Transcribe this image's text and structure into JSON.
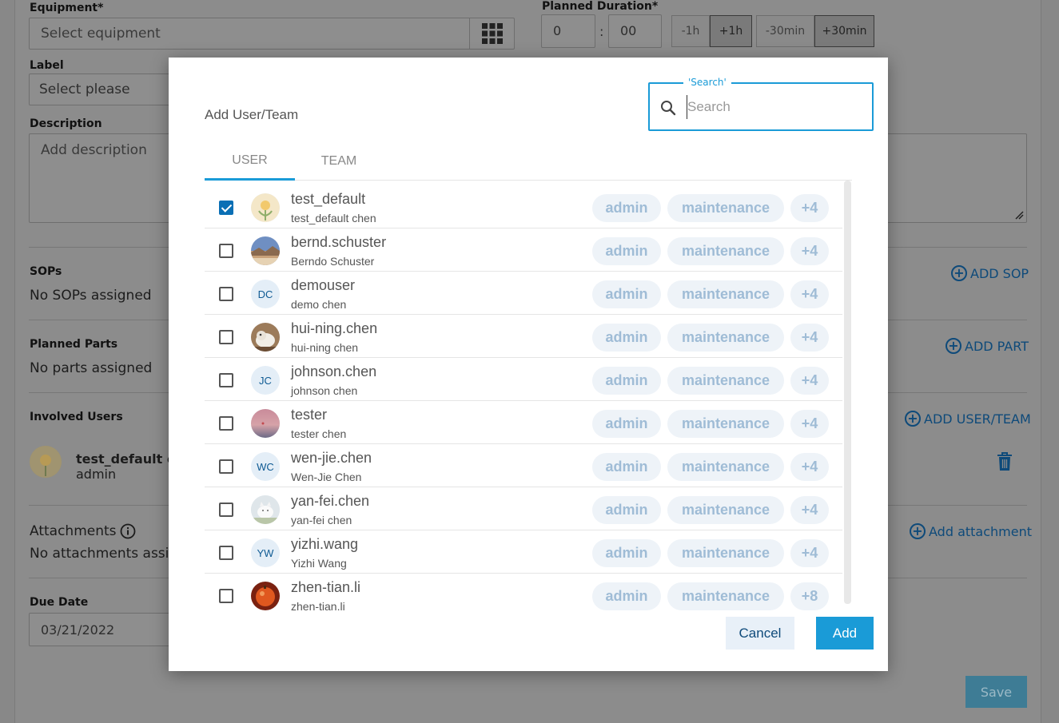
{
  "background": {
    "equipment_label": "Equipment*",
    "equipment_placeholder": "Select equipment",
    "planned_duration_label": "Planned Duration*",
    "duration_hours": "0",
    "duration_sep": ":",
    "duration_minutes": "00",
    "dur_minus_1h": "-1h",
    "dur_plus_1h": "+1h",
    "dur_minus_30": "-30min",
    "dur_plus_30": "+30min",
    "label_label": "Label",
    "label_placeholder": "Select please",
    "description_label": "Description",
    "description_placeholder": "Add description",
    "sops_label": "SOPs",
    "sops_value": "No SOPs assigned",
    "add_sop": "ADD SOP",
    "parts_label": "Planned Parts",
    "parts_value": "No parts assigned",
    "add_part": "ADD PART",
    "involved_label": "Involved Users",
    "add_user_team": "ADD USER/TEAM",
    "involved_user_name": "test_default ch",
    "involved_user_role": "admin",
    "attachments_label": "Attachments",
    "attachments_value": "No attachments assign",
    "add_attachment": "Add attachment",
    "due_date_label": "Due Date",
    "due_date_value": "03/21/2022",
    "save_label": "Save"
  },
  "modal": {
    "title": "Add User/Team",
    "search_legend": "'Search'",
    "search_placeholder": "Search",
    "tabs": [
      {
        "label": "USER",
        "active": true
      },
      {
        "label": "TEAM",
        "active": false
      }
    ],
    "users": [
      {
        "username": "test_default",
        "fullname": "test_default chen",
        "checked": true,
        "avatar": "flower",
        "initials": "",
        "roles": [
          "admin",
          "maintenance",
          "+4"
        ]
      },
      {
        "username": "bernd.schuster",
        "fullname": "Berndo Schuster",
        "checked": false,
        "avatar": "landscape",
        "initials": "",
        "roles": [
          "admin",
          "maintenance",
          "+4"
        ]
      },
      {
        "username": "demouser",
        "fullname": "demo chen",
        "checked": false,
        "avatar": "initials",
        "initials": "DC",
        "roles": [
          "admin",
          "maintenance",
          "+4"
        ]
      },
      {
        "username": "hui-ning.chen",
        "fullname": "hui-ning chen",
        "checked": false,
        "avatar": "dog",
        "initials": "",
        "roles": [
          "admin",
          "maintenance",
          "+4"
        ]
      },
      {
        "username": "johnson.chen",
        "fullname": "johnson chen",
        "checked": false,
        "avatar": "initials",
        "initials": "JC",
        "roles": [
          "admin",
          "maintenance",
          "+4"
        ]
      },
      {
        "username": "tester",
        "fullname": "tester chen",
        "checked": false,
        "avatar": "sunset",
        "initials": "",
        "roles": [
          "admin",
          "maintenance",
          "+4"
        ]
      },
      {
        "username": "wen-jie.chen",
        "fullname": "Wen-Jie Chen",
        "checked": false,
        "avatar": "initials",
        "initials": "WC",
        "roles": [
          "admin",
          "maintenance",
          "+4"
        ]
      },
      {
        "username": "yan-fei.chen",
        "fullname": "yan-fei chen",
        "checked": false,
        "avatar": "cat",
        "initials": "",
        "roles": [
          "admin",
          "maintenance",
          "+4"
        ]
      },
      {
        "username": "yizhi.wang",
        "fullname": "Yizhi Wang",
        "checked": false,
        "avatar": "initials",
        "initials": "YW",
        "roles": [
          "admin",
          "maintenance",
          "+4"
        ]
      },
      {
        "username": "zhen-tian.li",
        "fullname": "zhen-tian.li",
        "checked": false,
        "avatar": "orange",
        "initials": "",
        "roles": [
          "admin",
          "maintenance",
          "+8"
        ]
      }
    ],
    "cancel_label": "Cancel",
    "add_label": "Add"
  },
  "colors": {
    "accent": "#1a9bd7",
    "checkbox": "#0a6fb5",
    "chip_bg": "#eef3f8",
    "chip_text": "#9fbcd6",
    "overlay": "#888888"
  }
}
